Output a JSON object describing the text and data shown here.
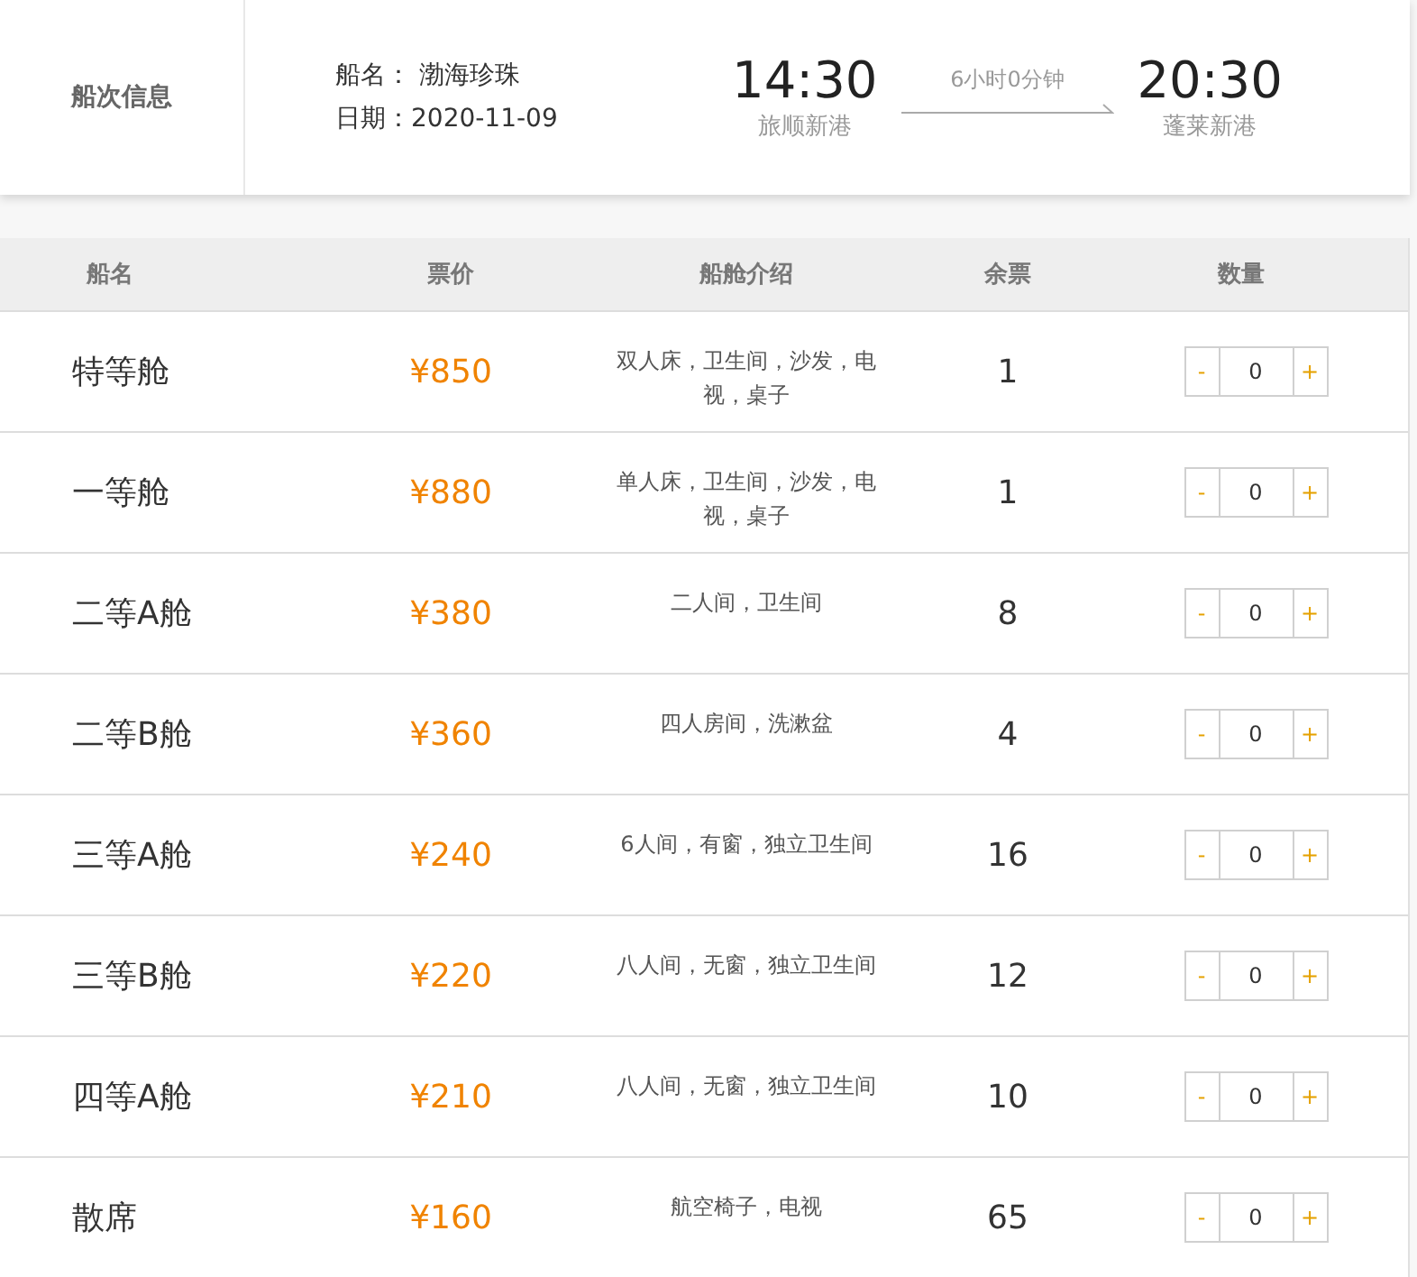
{
  "trip": {
    "section_label": "船次信息",
    "ship_label": "船名：",
    "ship_name": "渤海珍珠",
    "date_label": "日期：",
    "date": "2020-11-09",
    "depart_time": "14:30",
    "depart_port": "旅顺新港",
    "duration": "6小时0分钟",
    "arrive_time": "20:30",
    "arrive_port": "蓬莱新港"
  },
  "table": {
    "columns": [
      "船名",
      "票价",
      "船舱介绍",
      "余票",
      "数量"
    ],
    "rows": [
      {
        "cabin": "特等舱",
        "price": "¥850",
        "description": "双人床，卫生间，沙发，电视，桌子",
        "remaining": "1",
        "quantity": "0",
        "minus": "-",
        "plus": "+"
      },
      {
        "cabin": "一等舱",
        "price": "¥880",
        "description": "单人床，卫生间，沙发，电视，桌子",
        "remaining": "1",
        "quantity": "0",
        "minus": "-",
        "plus": "+"
      },
      {
        "cabin": "二等A舱",
        "price": "¥380",
        "description": "二人间，卫生间",
        "remaining": "8",
        "quantity": "0",
        "minus": "-",
        "plus": "+"
      },
      {
        "cabin": "二等B舱",
        "price": "¥360",
        "description": "四人房间，洗漱盆",
        "remaining": "4",
        "quantity": "0",
        "minus": "-",
        "plus": "+"
      },
      {
        "cabin": "三等A舱",
        "price": "¥240",
        "description": "6人间，有窗，独立卫生间",
        "remaining": "16",
        "quantity": "0",
        "minus": "-",
        "plus": "+"
      },
      {
        "cabin": "三等B舱",
        "price": "¥220",
        "description": "八人间，无窗，独立卫生间",
        "remaining": "12",
        "quantity": "0",
        "minus": "-",
        "plus": "+"
      },
      {
        "cabin": "四等A舱",
        "price": "¥210",
        "description": "八人间，无窗，独立卫生间",
        "remaining": "10",
        "quantity": "0",
        "minus": "-",
        "plus": "+"
      },
      {
        "cabin": "散席",
        "price": "¥160",
        "description": "航空椅子，电视",
        "remaining": "65",
        "quantity": "0",
        "minus": "-",
        "plus": "+"
      }
    ]
  }
}
